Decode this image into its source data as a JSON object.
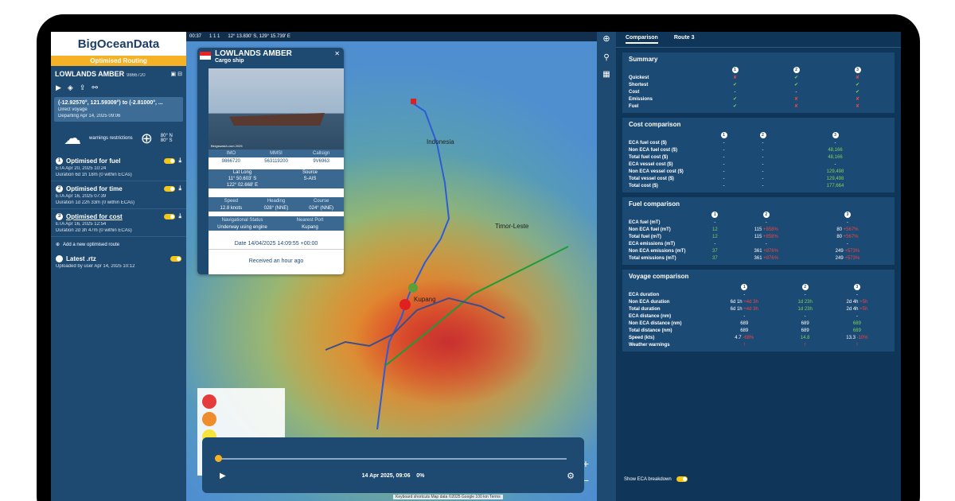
{
  "sidebar": {
    "logo": "BigOceanData",
    "banner": "Optimised Routing",
    "ship_name": "LOWLANDS AMBER",
    "ship_id": "9866720",
    "coords": "(-12.92570°, 121.59309°) to (-2.81000°, ...",
    "voyage_type": "Direct voyage",
    "departing": "Departing Apr 14, 2025 09:06",
    "warnings": "warnings restrictions",
    "lat_range_n": "80° N",
    "lat_range_s": "80° S",
    "options": [
      {
        "num": "1",
        "title": "Optimised for fuel",
        "eta": "ETA Apr 20, 2025 10:24",
        "duration": "Duration 6d 1h 18m (0 within ECAs)"
      },
      {
        "num": "2",
        "title": "Optimised for time",
        "eta": "ETA Apr 16, 2025 07:39",
        "duration": "Duration 1d 22h 33m (0 within ECAs)"
      },
      {
        "num": "3",
        "title": "Optimised for cost",
        "eta": "ETA Apr 16, 2025 12:54",
        "duration": "Duration 2d 3h 47m (0 within ECAs)"
      }
    ],
    "add_route": "Add a new optimised route",
    "latest_title": "Latest .rtz",
    "latest_sub": "Uploaded by user Apr 14, 2025 10:12"
  },
  "mapbar": {
    "time": "00:37",
    "counts": "1  1  1",
    "position": "12° 13.830' S, 129° 15.739' E"
  },
  "popup": {
    "name": "LOWLANDS AMBER",
    "type": "Cargo ship",
    "photo_credit": "Bergswatch.com 2025",
    "imo_label": "IMO",
    "imo": "9866720",
    "mmsi_label": "MMSI",
    "mmsi": "563119200",
    "callsign_label": "Callsign",
    "callsign": "9V6963",
    "latlong_label": "Lat Long",
    "lat": "11° 50.603' S",
    "long": "122° 02.668' E",
    "source_label": "Source",
    "source": "S-AIS",
    "speed_label": "Speed",
    "speed": "12.8 knots",
    "heading_label": "Heading",
    "heading": "028° (NNE)",
    "course_label": "Course",
    "course": "024° (NNE)",
    "nav_label": "Navigational Status",
    "nav": "Underway using engine",
    "port_label": "Nearest Port",
    "port": "Kupang",
    "date": "Date 14/04/2025 14:09:55 +00:00",
    "received": "Received an hour ago"
  },
  "map_labels": {
    "indonesia": "Indonesia",
    "timor": "Timor-Leste",
    "kupang": "Kupang"
  },
  "timeline": {
    "label": "14 Apr 2025, 09:06",
    "percent": "0%",
    "progress": 0
  },
  "attribution": "Keyboard shortcuts   Map data ©2025 Google   100 km   Terms",
  "right": {
    "tabs": [
      "Comparison",
      "Route 3"
    ],
    "summary": {
      "title": "Summary",
      "rows": [
        {
          "label": "Quickest",
          "v": [
            "✘",
            "✔",
            "✘"
          ],
          "c": [
            "rd",
            "g",
            "rd"
          ]
        },
        {
          "label": "Shortest",
          "v": [
            "✔",
            "✔",
            "✔"
          ],
          "c": [
            "g",
            "g",
            "g"
          ]
        },
        {
          "label": "Cost",
          "v": [
            "-",
            "-",
            "✔"
          ],
          "c": [
            "",
            "",
            "g"
          ]
        },
        {
          "label": "Emissions",
          "v": [
            "✔",
            "✘",
            "✘"
          ],
          "c": [
            "g",
            "rd",
            "rd"
          ]
        },
        {
          "label": "Fuel",
          "v": [
            "✔",
            "✘",
            "✘"
          ],
          "c": [
            "g",
            "rd",
            "rd"
          ]
        }
      ]
    },
    "cost": {
      "title": "Cost comparison",
      "rows": [
        {
          "label": "ECA fuel cost ($)",
          "v": [
            "-",
            "-",
            "-"
          ]
        },
        {
          "label": "Non ECA fuel cost ($)",
          "v": [
            "-",
            "-",
            "48,166"
          ]
        },
        {
          "label": "Total fuel cost ($)",
          "v": [
            "-",
            "-",
            "48,166"
          ]
        },
        {
          "label": "ECA vessel cost ($)",
          "v": [
            "-",
            "-",
            "-"
          ]
        },
        {
          "label": "Non ECA vessel cost ($)",
          "v": [
            "-",
            "-",
            "129,498"
          ]
        },
        {
          "label": "Total vessel cost ($)",
          "v": [
            "-",
            "-",
            "129,498"
          ]
        },
        {
          "label": "Total cost ($)",
          "v": [
            "-",
            "-",
            "177,664"
          ]
        }
      ]
    },
    "fuel": {
      "title": "Fuel comparison",
      "rows": [
        {
          "label": "ECA fuel (mT)",
          "v": [
            "-",
            "-",
            "-"
          ]
        },
        {
          "label": "Non ECA fuel (mT)",
          "v": [
            "12",
            "115",
            "80"
          ],
          "d": [
            "",
            "+858%",
            "+567%"
          ]
        },
        {
          "label": "Total fuel (mT)",
          "v": [
            "12",
            "115",
            "80"
          ],
          "d": [
            "",
            "+858%",
            "+567%"
          ]
        },
        {
          "label": "ECA emissions (mT)",
          "v": [
            "-",
            "-",
            "-"
          ]
        },
        {
          "label": "Non ECA emissions (mT)",
          "v": [
            "37",
            "361",
            "249"
          ],
          "d": [
            "",
            "+876%",
            "+573%"
          ]
        },
        {
          "label": "Total emissions (mT)",
          "v": [
            "37",
            "361",
            "249"
          ],
          "d": [
            "",
            "+876%",
            "+573%"
          ]
        }
      ]
    },
    "voyage": {
      "title": "Voyage comparison",
      "rows": [
        {
          "label": "ECA duration",
          "v": [
            "-",
            "-",
            "-"
          ]
        },
        {
          "label": "Non ECA duration",
          "v": [
            "6d 1h",
            "1d 23h",
            "2d 4h"
          ],
          "d": [
            "+4d 3h",
            "",
            "+5h"
          ]
        },
        {
          "label": "Total duration",
          "v": [
            "6d 1h",
            "1d 23h",
            "2d 4h"
          ],
          "d": [
            "+4d 3h",
            "",
            "+5h"
          ]
        },
        {
          "label": "ECA distance (nm)",
          "v": [
            "-",
            "-",
            "-"
          ]
        },
        {
          "label": "Non ECA distance (nm)",
          "v": [
            "689",
            "689",
            "689"
          ]
        },
        {
          "label": "Total distance (nm)",
          "v": [
            "689",
            "689",
            "689"
          ]
        },
        {
          "label": "Speed (kts)",
          "v": [
            "4.7",
            "14.8",
            "13.3"
          ],
          "d": [
            "-68%",
            "",
            "-10%"
          ]
        },
        {
          "label": "Weather warnings",
          "v": [
            "!",
            "!",
            "!"
          ]
        }
      ]
    },
    "eca_label": "Show ECA breakdown"
  }
}
